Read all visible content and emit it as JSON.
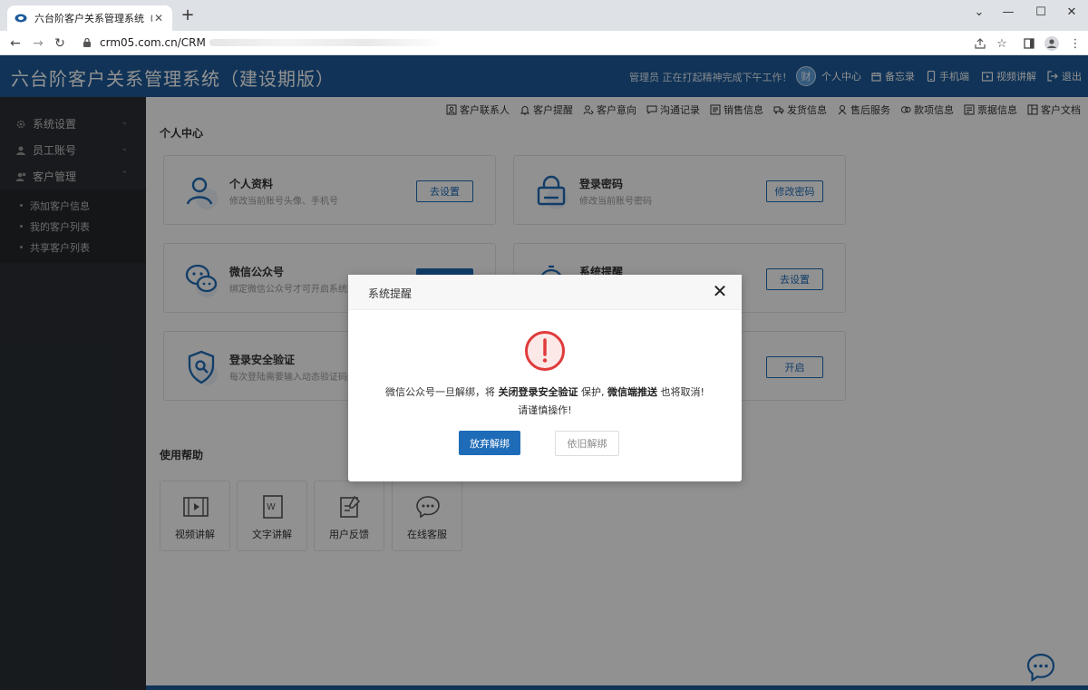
{
  "browser": {
    "tab_title": "六台阶客户关系管理系统（建设期",
    "url": "crm05.com.cn/CRM"
  },
  "header": {
    "app_title": "六台阶客户关系管理系统（建设期版）",
    "greeting": "管理员 正在打起精神完成下午工作！",
    "avatar_text": "财",
    "nav": [
      "个人中心",
      "备忘录",
      "手机端",
      "视频讲解",
      "退出"
    ]
  },
  "sidebar": {
    "items": [
      {
        "label": "系统设置",
        "icon": "gear-icon"
      },
      {
        "label": "员工账号",
        "icon": "user-icon"
      },
      {
        "label": "客户管理",
        "icon": "users-icon"
      }
    ],
    "subitems": [
      "添加客户信息",
      "我的客户列表",
      "共享客户列表"
    ]
  },
  "toolbar": {
    "items": [
      {
        "label": "客户联系人",
        "icon": "contact-icon"
      },
      {
        "label": "客户提醒",
        "icon": "bell-icon"
      },
      {
        "label": "客户意向",
        "icon": "intent-icon"
      },
      {
        "label": "沟通记录",
        "icon": "chat-icon"
      },
      {
        "label": "销售信息",
        "icon": "sales-icon"
      },
      {
        "label": "发货信息",
        "icon": "truck-icon"
      },
      {
        "label": "售后服务",
        "icon": "service-icon"
      },
      {
        "label": "款项信息",
        "icon": "money-icon"
      },
      {
        "label": "票据信息",
        "icon": "receipt-icon"
      },
      {
        "label": "客户文档",
        "icon": "doc-icon"
      }
    ]
  },
  "personal_center": {
    "title": "个人中心",
    "cards": [
      {
        "title": "个人资料",
        "desc": "修改当前账号头像、手机号",
        "button": "去设置",
        "icon": "profile-icon"
      },
      {
        "title": "登录密码",
        "desc": "修改当前账号密码",
        "button": "修改密码",
        "icon": "password-icon"
      },
      {
        "title": "微信公众号",
        "desc": "绑定微信公众号才可开启系统提醒",
        "button": "",
        "icon": "wechat-icon"
      },
      {
        "title": "系统提醒",
        "desc": "",
        "button": "去设置",
        "icon": "alarm-icon"
      },
      {
        "title": "登录安全验证",
        "desc": "每次登陆需要输入动态验证码进行",
        "button": "",
        "icon": "shield-icon"
      },
      {
        "title": "",
        "desc": "",
        "button": "开启",
        "icon": ""
      }
    ]
  },
  "help": {
    "title": "使用帮助",
    "items": [
      {
        "label": "视频讲解",
        "icon": "video-icon"
      },
      {
        "label": "文字讲解",
        "icon": "word-icon"
      },
      {
        "label": "用户反馈",
        "icon": "feedback-icon"
      },
      {
        "label": "在线客服",
        "icon": "support-icon"
      }
    ]
  },
  "modal": {
    "title": "系统提醒",
    "msg_pre": "微信公众号一旦解绑，将",
    "msg_b1": "关闭登录安全验证",
    "msg_mid": "保护,",
    "msg_b2": "微信端推送",
    "msg_post": "也将取消!",
    "msg_line2": "请谨慎操作!",
    "primary_button": "放弃解绑",
    "secondary_button": "依旧解绑"
  },
  "colors": {
    "brand": "#1d5a9a",
    "primary_button": "#1e6bb8",
    "warning": "#e03b3b",
    "sidebar_bg": "#2b2f33"
  }
}
